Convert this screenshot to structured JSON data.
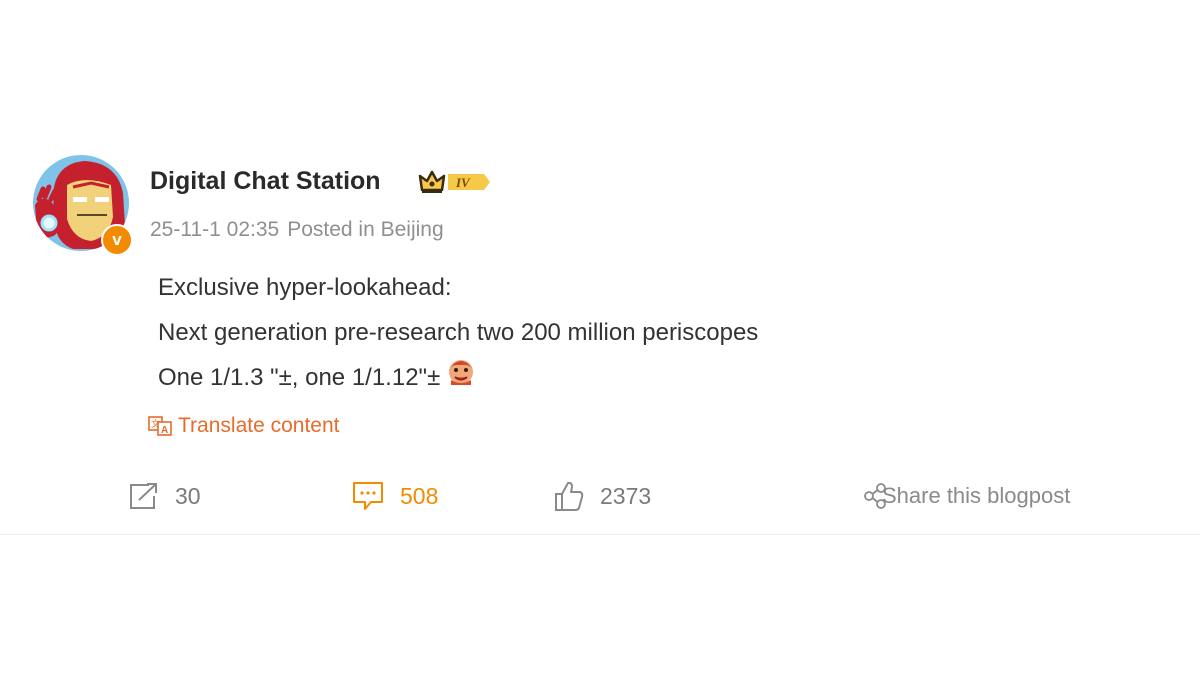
{
  "post": {
    "author": "Digital Chat Station",
    "vip_level": "IV",
    "verified_mark": "v",
    "timestamp": "25-11-1 02:35",
    "location": "Posted in Beijing",
    "lines": [
      "Exclusive hyper-lookahead:",
      "Next generation pre-research two 200 million periscopes",
      "One 1/1.3 \"±, one 1/1.12\"±"
    ],
    "translate_label": "Translate content"
  },
  "actions": {
    "repost_count": "30",
    "comment_count": "508",
    "like_count": "2373",
    "share_label": "Share this blogpost"
  },
  "icons": {
    "avatar": "iron-man-avatar",
    "vip": "crown-badge-icon",
    "repost": "repost-icon",
    "comment": "comment-icon",
    "like": "thumbs-up-icon",
    "share": "share-icon",
    "translate": "translate-icon",
    "emoji": "cheeky-emoji-icon"
  },
  "colors": {
    "accent": "#f38b00",
    "translate": "#e86b2b",
    "text": "#333333",
    "meta": "#8f8f8f"
  }
}
